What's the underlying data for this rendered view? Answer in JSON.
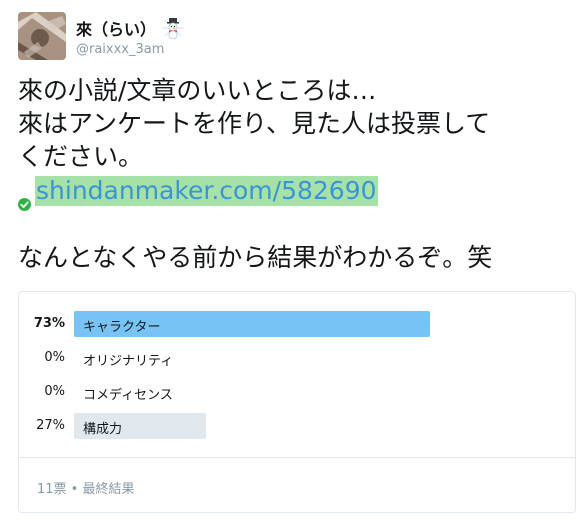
{
  "user": {
    "display_name": "來（らい）",
    "username": "@raixxx_3am",
    "name_emoji": "snowman-emoji"
  },
  "tweet": {
    "lines": [
      "來の小説/文章のいいところは…",
      "來はアンケートを作り、見た人は投票して",
      "ください。"
    ],
    "link_text": "shindanmaker.com/582690",
    "closing_line": "なんとなくやる前から結果がわかるぞ。笑",
    "colors": {
      "link": "#3a95d6",
      "link_highlight": "#a6e1a8"
    }
  },
  "poll": {
    "options": [
      {
        "percent_label": "73%",
        "label": "キャラクター",
        "value": 73,
        "winner": true
      },
      {
        "percent_label": "0%",
        "label": "オリジナリティ",
        "value": 0,
        "winner": false
      },
      {
        "percent_label": "0%",
        "label": "コメディセンス",
        "value": 0,
        "winner": false
      },
      {
        "percent_label": "27%",
        "label": "構成力",
        "value": 27,
        "winner": false
      }
    ],
    "footer": "11票 • 最終結果",
    "colors": {
      "winner_bar": "#77c3f4",
      "other_bar": "#e1e8ed"
    }
  }
}
